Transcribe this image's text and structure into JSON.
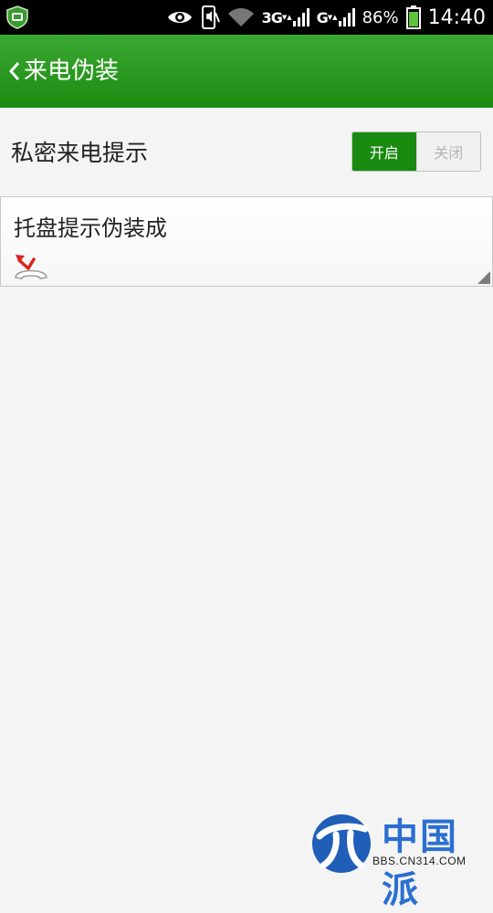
{
  "status_bar": {
    "battery": "86%",
    "time": "14:40",
    "network1": "3G",
    "network2": "G",
    "icons": [
      "app-shield-icon",
      "eye-icon",
      "silent-phone-icon",
      "wifi-icon",
      "signal-icon",
      "battery-icon"
    ]
  },
  "header": {
    "title": "来电伪装"
  },
  "settings": {
    "private_call": {
      "label": "私密来电提示",
      "on_label": "开启",
      "off_label": "关闭",
      "selected": "开启"
    },
    "tray_disguise": {
      "label": "托盘提示伪装成",
      "icon": "missed-call-icon"
    }
  },
  "watermark": {
    "title": "中国派",
    "url": "BBS.CN314.COM"
  },
  "colors": {
    "header_green": "#1d8b12",
    "toggle_on": "#198a10",
    "background": "#f4f4f4"
  }
}
